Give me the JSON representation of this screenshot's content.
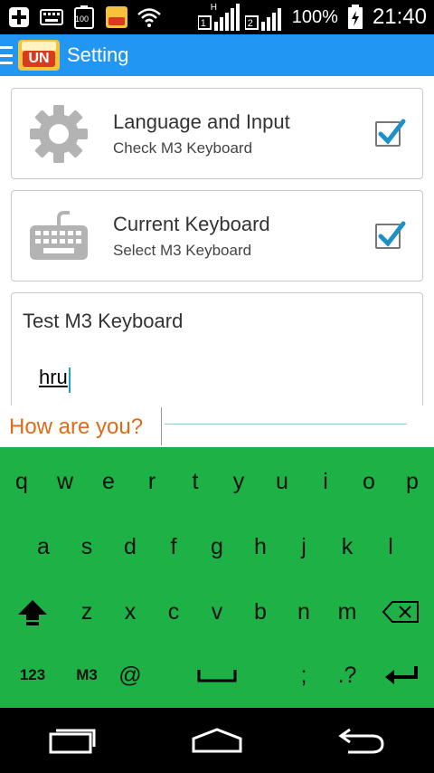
{
  "status_bar": {
    "left_icons": [
      "plus-box-icon",
      "keyboard-icon",
      "battery-100-icon",
      "app-logo-icon",
      "wifi-icon"
    ],
    "battery_badge": "100",
    "signal_labels": [
      "H",
      "1",
      "2"
    ],
    "battery_percent": "100%",
    "time": "21:40"
  },
  "app_bar": {
    "title": "Setting",
    "logo_badge": "UN"
  },
  "cards": [
    {
      "title": "Language and Input",
      "subtitle": "Check M3 Keyboard",
      "checked": true,
      "icon": "gear-icon"
    },
    {
      "title": "Current Keyboard",
      "subtitle": "Select M3 Keyboard",
      "checked": true,
      "icon": "keyboard-icon"
    }
  ],
  "test_card": {
    "title": "Test M3 Keyboard",
    "input_value": "hru"
  },
  "suggestion": {
    "text": "How are you?"
  },
  "keyboard": {
    "row1": [
      "q",
      "w",
      "e",
      "r",
      "t",
      "y",
      "u",
      "i",
      "o",
      "p"
    ],
    "row2": [
      "a",
      "s",
      "d",
      "f",
      "g",
      "h",
      "j",
      "k",
      "l"
    ],
    "row3": [
      "z",
      "x",
      "c",
      "v",
      "b",
      "n",
      "m"
    ],
    "row4": {
      "numbers": "123",
      "lang": "M3",
      "at": "@",
      "semicolon": ";",
      "dotq": ".?"
    },
    "colors": {
      "background": "#1eb145"
    }
  },
  "nav_bar": {
    "buttons": [
      "recent-apps-icon",
      "home-icon",
      "back-icon"
    ]
  },
  "colors": {
    "app_bar": "#2196f3",
    "suggestion_text": "#e06a16",
    "checkbox_check": "#1e90c8"
  }
}
